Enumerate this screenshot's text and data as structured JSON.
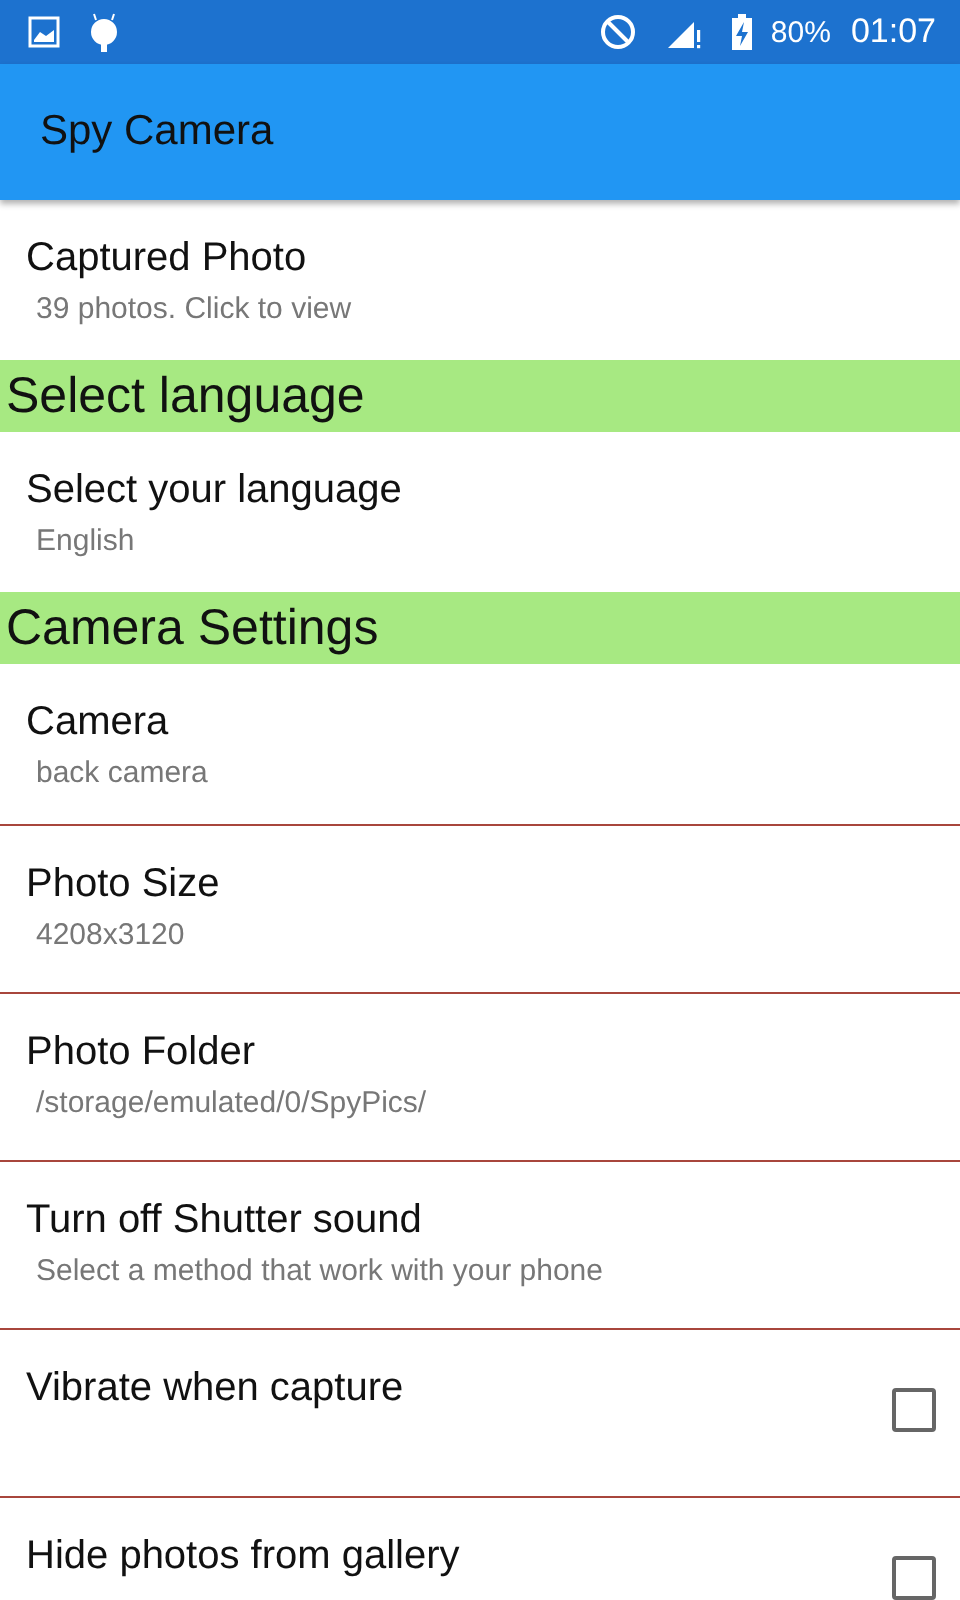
{
  "status_bar": {
    "battery": "80%",
    "time": "01:07"
  },
  "app_bar": {
    "title": "Spy Camera"
  },
  "items": [
    {
      "kind": "item",
      "title": "Captured Photo",
      "summary": "39 photos. Click to view"
    }
  ],
  "sections": [
    {
      "title": "Select language",
      "items": [
        {
          "kind": "item",
          "title": "Select your language",
          "summary": "English"
        }
      ]
    },
    {
      "title": "Camera Settings",
      "items": [
        {
          "kind": "item",
          "title": "Camera",
          "summary": "back camera"
        },
        {
          "kind": "item",
          "title": "Photo Size",
          "summary": "4208x3120"
        },
        {
          "kind": "item",
          "title": "Photo Folder",
          "summary": "/storage/emulated/0/SpyPics/"
        },
        {
          "kind": "item",
          "title": "Turn off Shutter sound",
          "summary": "Select a method that work with your phone"
        },
        {
          "kind": "checkbox",
          "title": "Vibrate when capture",
          "checked": false
        },
        {
          "kind": "checkbox",
          "title": "Hide photos from gallery",
          "checked": false
        }
      ]
    }
  ]
}
